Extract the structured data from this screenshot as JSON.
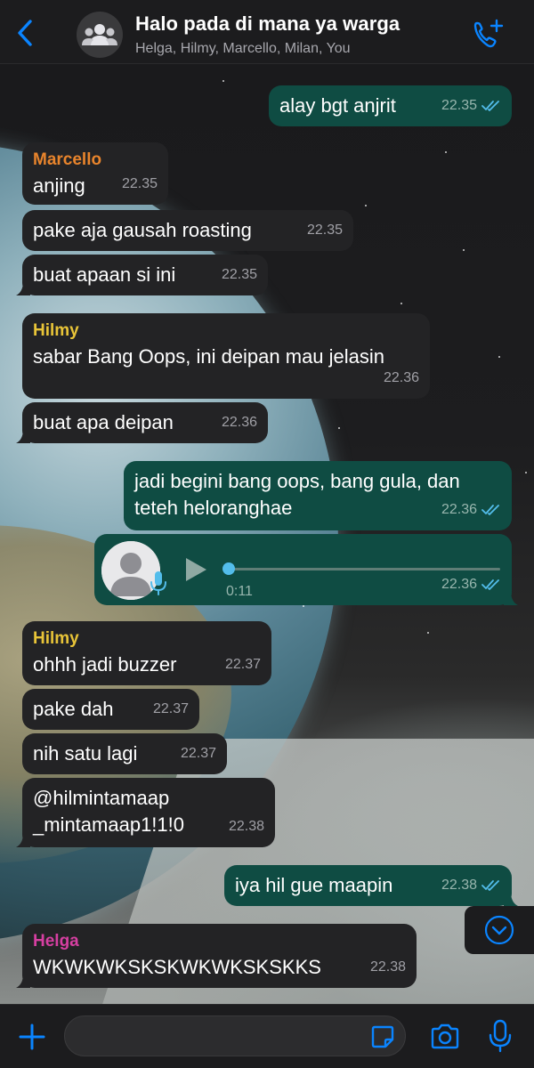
{
  "header": {
    "back_icon": "chevron-left-icon",
    "group_avatar_icon": "group-icon",
    "title": "Halo pada di mana ya warga",
    "members": "Helga, Hilmy, Marcello, Milan, You",
    "call_icon": "phone-plus-icon"
  },
  "colors": {
    "accent": "#0a84ff",
    "tick_read": "#53bdeb",
    "marcello": "#e8842c",
    "hilmy": "#e8c438",
    "helga": "#d63fa1",
    "bubble_in": "#232325",
    "bubble_out": "#0f4c43"
  },
  "messages": [
    {
      "dir": "out",
      "text": "alay bgt anjrit",
      "time": "22.35",
      "status": "read"
    },
    {
      "dir": "in",
      "sender": "Marcello",
      "text": "anjing",
      "time": "22.35"
    },
    {
      "dir": "in",
      "text": "pake aja gausah roasting",
      "time": "22.35"
    },
    {
      "dir": "in",
      "text": "buat apaan si ini",
      "time": "22.35"
    },
    {
      "dir": "in",
      "sender": "Hilmy",
      "text": "sabar Bang Oops, ini deipan mau jelasin",
      "time": "22.36"
    },
    {
      "dir": "in",
      "text": "buat apa deipan",
      "time": "22.36"
    },
    {
      "dir": "out",
      "text_line1": "jadi begini bang oops, bang gula, dan",
      "text_line2": "teteh heloranghae",
      "time": "22.36",
      "status": "read"
    },
    {
      "dir": "out",
      "type": "voice",
      "duration": "0:11",
      "time": "22.36",
      "status": "read",
      "progress": 0
    },
    {
      "dir": "in",
      "sender": "Hilmy",
      "text": "ohhh jadi buzzer",
      "time": "22.37"
    },
    {
      "dir": "in",
      "text": "pake dah",
      "time": "22.37"
    },
    {
      "dir": "in",
      "text": "nih satu lagi",
      "time": "22.37"
    },
    {
      "dir": "in",
      "text_line1": "@hilmintamaap",
      "text_line2": "_mintamaap1!1!0",
      "time": "22.38"
    },
    {
      "dir": "out",
      "text": "iya hil gue maapin",
      "time": "22.38",
      "status": "read"
    },
    {
      "dir": "in",
      "sender": "Helga",
      "text": "WKWKWKSKSKWKWKSKSKKS",
      "time": "22.38"
    }
  ],
  "scroll_down_icon": "chevron-down-circle-icon",
  "composer": {
    "plus_icon": "plus-icon",
    "input_value": "",
    "input_placeholder": "",
    "sticker_icon": "sticker-icon",
    "camera_icon": "camera-icon",
    "mic_icon": "microphone-icon"
  }
}
